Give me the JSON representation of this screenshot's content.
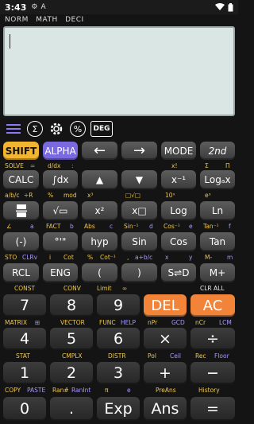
{
  "status": {
    "time": "3:43",
    "app_icons": [
      "⚙",
      "A"
    ]
  },
  "modes": [
    "NORM",
    "MATH",
    "DECI"
  ],
  "toolbar": {
    "deg": "DEG",
    "sigma": "Σ",
    "percent": "%"
  },
  "buttons": {
    "shift": "SHIFT",
    "alpha": "ALPHA",
    "left": "←",
    "right": "→",
    "mode": "MODE",
    "second": "2nd",
    "calc": "CALC",
    "integral": "∫dx",
    "up": "▲",
    "down": "▼",
    "inverse": "x⁻¹",
    "log_base": "Logₐx",
    "frac": "▭",
    "sqrt": "√▭",
    "square": "x²",
    "power": "x□",
    "log": "Log",
    "ln": "Ln",
    "neg": "(-)",
    "dms": "°'\"",
    "hyp": "hyp",
    "sin": "Sin",
    "cos": "Cos",
    "tan": "Tan",
    "rcl": "RCL",
    "eng": "ENG",
    "lparen": "(",
    "rparen": ")",
    "sd": "S⇌D",
    "mplus": "M+",
    "n7": "7",
    "n8": "8",
    "n9": "9",
    "del": "DEL",
    "ac": "AC",
    "n4": "4",
    "n5": "5",
    "n6": "6",
    "times": "×",
    "divide": "÷",
    "n1": "1",
    "n2": "2",
    "n3": "3",
    "plus": "+",
    "minus": "−",
    "n0": "0",
    "dot": ".",
    "exp": "Exp",
    "ans": "Ans",
    "equals": "="
  },
  "sublabels": {
    "r1": [
      "SOLVE",
      "=",
      "d/dx",
      ":",
      "x!",
      "Σ",
      "Π"
    ],
    "r2": [
      "a/b/c",
      "÷R",
      "%",
      "mod",
      "x³",
      "□√□",
      "10ˣ",
      "eˣ"
    ],
    "r3": [
      "∠",
      "a",
      "FACT",
      "b",
      "Abs",
      "c",
      "Sin⁻¹",
      "d",
      "Cos⁻¹",
      "e",
      "Tan⁻¹",
      "f"
    ],
    "r4": [
      "STO",
      "CLRv",
      "i",
      "Cot",
      "%",
      "Cot⁻¹",
      ",",
      "a+b/c",
      "x",
      "y",
      "M-",
      "m"
    ],
    "r5": [
      "CONST",
      "CONV",
      "Limit",
      "∞",
      "CLR ALL"
    ],
    "r6": [
      "MATRIX",
      "⊞",
      "VECTOR",
      "FUNC",
      "HELP",
      "nPr",
      "GCD",
      "nCr",
      "LCM"
    ],
    "r7": [
      "STAT",
      "CMPLX",
      "DISTR",
      "Pol",
      "Ceil",
      "Rec",
      "Floor"
    ],
    "r8": [
      "COPY",
      "PASTE",
      "Ran#",
      "RanInt",
      "π",
      "e",
      "PreAns",
      "History"
    ]
  },
  "colors": {
    "shift": "#f2b531",
    "alpha": "#7a6ae0",
    "del": "#f2843a",
    "screen": "#d9e6e4"
  }
}
